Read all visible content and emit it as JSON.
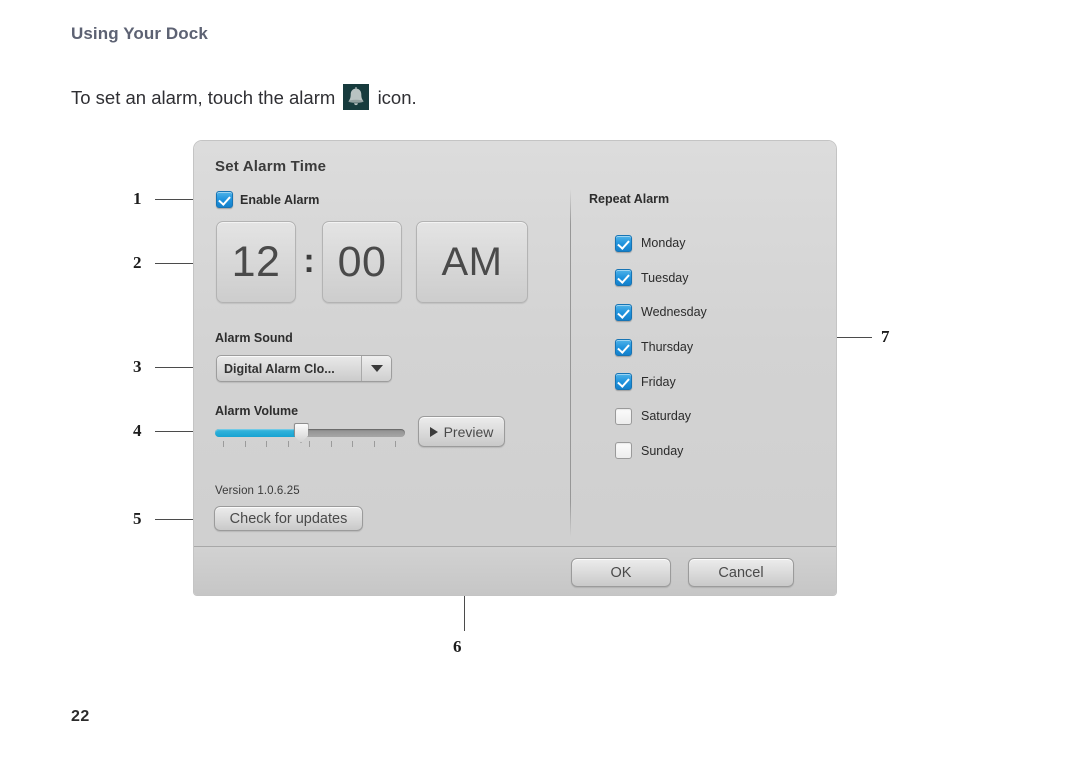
{
  "document": {
    "heading": "Using Your Dock",
    "body_before": "To set an alarm, touch the alarm",
    "body_after": "icon.",
    "bell_icon_name": "alarm-bell-icon",
    "page_number": "22"
  },
  "callouts": [
    {
      "id": "1",
      "label": "1"
    },
    {
      "id": "2",
      "label": "2"
    },
    {
      "id": "3",
      "label": "3"
    },
    {
      "id": "4",
      "label": "4"
    },
    {
      "id": "5",
      "label": "5"
    },
    {
      "id": "6",
      "label": "6"
    },
    {
      "id": "7",
      "label": "7"
    }
  ],
  "dialog": {
    "title": "Set Alarm Time",
    "enable_alarm": {
      "label": "Enable Alarm",
      "checked": true
    },
    "time": {
      "hours": "12",
      "separator": ":",
      "minutes": "00",
      "meridiem": "AM"
    },
    "alarm_sound": {
      "label": "Alarm Sound",
      "selected": "Digital Alarm Clo...",
      "dropdown_icon": "chevron-down-icon"
    },
    "alarm_volume": {
      "label": "Alarm Volume",
      "value_percent": 45,
      "tick_count": 9
    },
    "preview": {
      "label": "Preview",
      "icon": "play-icon"
    },
    "version": {
      "text": "Version 1.0.6.25",
      "update_button": "Check for updates"
    },
    "repeat_alarm": {
      "title": "Repeat Alarm",
      "days": [
        {
          "label": "Monday",
          "checked": true
        },
        {
          "label": "Tuesday",
          "checked": true
        },
        {
          "label": "Wednesday",
          "checked": true
        },
        {
          "label": "Thursday",
          "checked": true
        },
        {
          "label": "Friday",
          "checked": true
        },
        {
          "label": "Saturday",
          "checked": false
        },
        {
          "label": "Sunday",
          "checked": false
        }
      ]
    },
    "footer": {
      "ok": "OK",
      "cancel": "Cancel"
    }
  },
  "colors": {
    "accent_blue": "#1f93dd",
    "slider_cyan": "#17a3d2",
    "heading_gray": "#5d6273",
    "bell_badge": "#173b3d",
    "dialog_bg": "#d3d3d3"
  }
}
